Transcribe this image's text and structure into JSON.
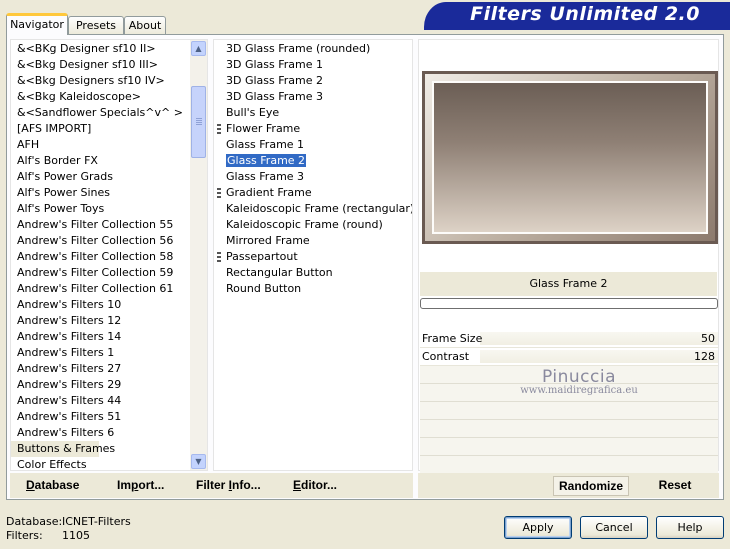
{
  "tabs": [
    "Navigator",
    "Presets",
    "About"
  ],
  "active_tab": "Navigator",
  "banner": {
    "title": "Filters Unlimited 2.0",
    "color": "#1a2a9a"
  },
  "categories": [
    "&<BKg Designer sf10 II>",
    "&<Bkg Designer sf10 III>",
    "&<Bkg Designers sf10 IV>",
    "&<Bkg Kaleidoscope>",
    "&<Sandflower Specials^v^ >",
    "[AFS IMPORT]",
    "AFH",
    "Alf's Border FX",
    "Alf's Power Grads",
    "Alf's Power Sines",
    "Alf's Power Toys",
    "Andrew's Filter Collection 55",
    "Andrew's Filter Collection 56",
    "Andrew's Filter Collection 58",
    "Andrew's Filter Collection 59",
    "Andrew's Filter Collection 61",
    "Andrew's Filters 10",
    "Andrew's Filters 12",
    "Andrew's Filters 14",
    "Andrew's Filters 1",
    "Andrew's Filters 27",
    "Andrew's Filters 29",
    "Andrew's Filters 44",
    "Andrew's Filters 51",
    "Andrew's Filters 6",
    "Buttons & Frames",
    "Color Effects"
  ],
  "selected_category": "Buttons & Frames",
  "filters": [
    {
      "name": "3D Glass Frame (rounded)",
      "group": false
    },
    {
      "name": "3D Glass Frame 1",
      "group": false
    },
    {
      "name": "3D Glass Frame 2",
      "group": false
    },
    {
      "name": "3D Glass Frame 3",
      "group": false
    },
    {
      "name": "Bull's Eye",
      "group": false
    },
    {
      "name": "Flower Frame",
      "group": true
    },
    {
      "name": "Glass Frame 1",
      "group": false
    },
    {
      "name": "Glass Frame 2",
      "group": false
    },
    {
      "name": "Glass Frame 3",
      "group": false
    },
    {
      "name": "Gradient Frame",
      "group": true
    },
    {
      "name": "Kaleidoscopic Frame (rectangular)",
      "group": false
    },
    {
      "name": "Kaleidoscopic Frame (round)",
      "group": false
    },
    {
      "name": "Mirrored Frame",
      "group": false
    },
    {
      "name": "Passepartout",
      "group": true
    },
    {
      "name": "Rectangular Button",
      "group": false
    },
    {
      "name": "Round Button",
      "group": false
    }
  ],
  "selected_filter": "Glass Frame 2",
  "preview": {
    "filter_name": "Glass Frame 2"
  },
  "params": [
    {
      "label": "Frame Size",
      "value": "50"
    },
    {
      "label": "Contrast",
      "value": "128"
    }
  ],
  "watermark": {
    "line1": "Pinuccia",
    "line2": "www.maidiregrafica.eu"
  },
  "toolbar": {
    "database": {
      "mnemonic": "D",
      "rest": "atabase"
    },
    "import": {
      "before": "Im",
      "mnemonic": "p",
      "rest": "ort..."
    },
    "filter_info": {
      "before": "Filter ",
      "mnemonic": "I",
      "rest": "nfo..."
    },
    "editor": {
      "mnemonic": "E",
      "rest": "ditor..."
    },
    "randomize": "Randomize",
    "reset": "Reset"
  },
  "status": {
    "database_label": "Database:",
    "database_value": "ICNET-Filters",
    "filters_label": "Filters:",
    "filters_value": "1105"
  },
  "buttons": {
    "apply": "Apply",
    "cancel": "Cancel",
    "help": "Help"
  }
}
